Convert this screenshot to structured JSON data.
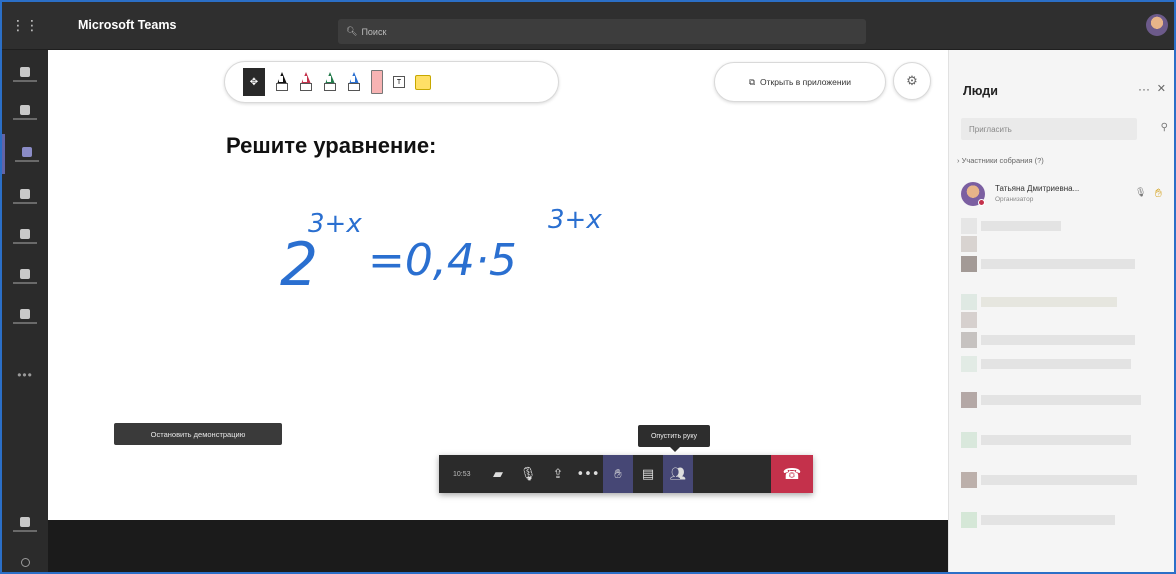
{
  "topbar": {
    "app_title": "Microsoft Teams",
    "search_placeholder": "Поиск"
  },
  "whiteboard": {
    "heading": "Решите уравнение:",
    "equation": "2^(3+x) = 0,4·5^(3+x)",
    "open_in_app_label": "Открыть в приложении"
  },
  "share": {
    "stop_label": "Остановить демонстрацию"
  },
  "callbar": {
    "time": "10:53",
    "tooltip": "Опустить руку"
  },
  "people_panel": {
    "title": "Люди",
    "invite_placeholder": "Пригласить",
    "section_label": "Участники собрания (?)",
    "participant": {
      "name": "Татьяна Дмитриевна...",
      "role": "Организатор"
    }
  },
  "colors": {
    "frame_border": "#2b6fc7",
    "rail_bg": "#2b2b2b",
    "topbar_bg": "#2f2f2f",
    "accent": "#464775",
    "hangup": "#c4314b",
    "ink_blue": "#2a6fd0"
  },
  "icons": {
    "waffle": "waffle-icon",
    "search": "search-icon",
    "settings": "gear-icon",
    "raise_hand": "hand-icon",
    "hangup": "phone-hangup-icon"
  }
}
